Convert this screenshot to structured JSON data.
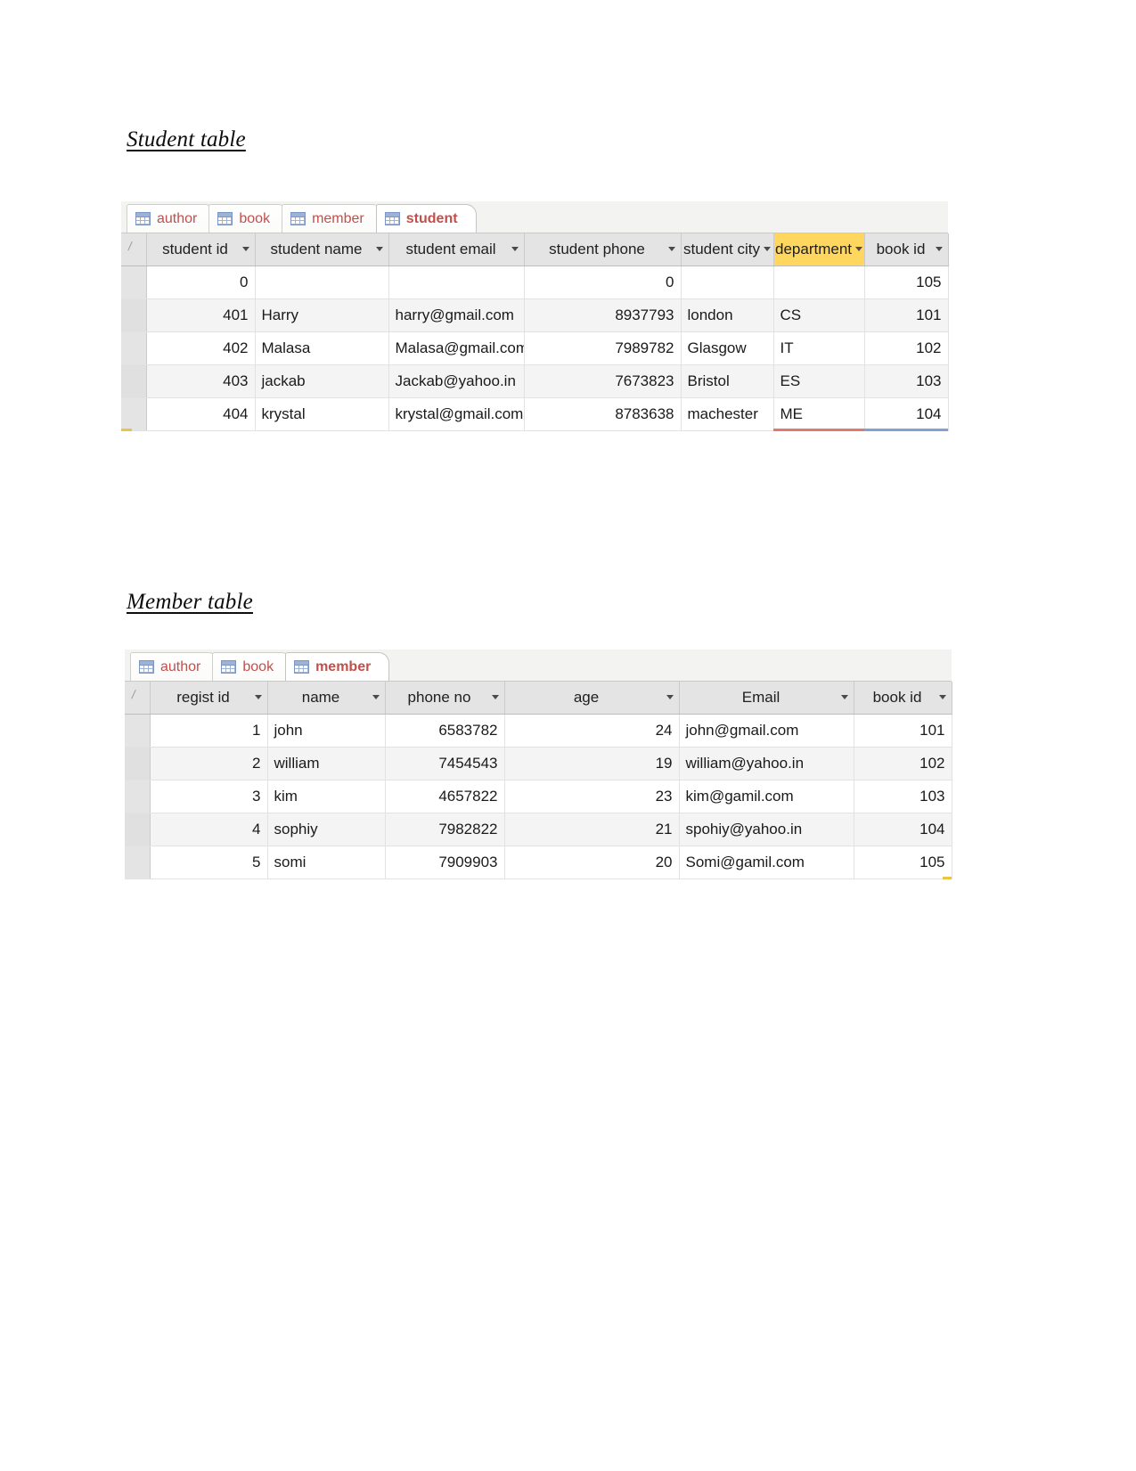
{
  "document": {
    "sections": [
      {
        "heading": "Student table"
      },
      {
        "heading": "Member table"
      }
    ]
  },
  "student_table": {
    "heading": "Student table",
    "tabs": [
      {
        "label": "author",
        "active": false,
        "icon": "table-grid-icon"
      },
      {
        "label": "book",
        "active": false,
        "icon": "table-grid-icon"
      },
      {
        "label": "member",
        "active": false,
        "icon": "table-grid-icon"
      },
      {
        "label": "student",
        "active": true,
        "icon": "table-grid-icon"
      }
    ],
    "columns": [
      {
        "label": "student id",
        "align": "num",
        "selected": false
      },
      {
        "label": "student name",
        "align": "txt",
        "selected": false
      },
      {
        "label": "student email",
        "align": "txt",
        "selected": false
      },
      {
        "label": "student phone",
        "align": "num",
        "selected": false
      },
      {
        "label": "student city",
        "align": "txt",
        "selected": false
      },
      {
        "label": "department",
        "align": "txt",
        "selected": true
      },
      {
        "label": "book id",
        "align": "num",
        "selected": false
      }
    ],
    "rows": [
      [
        "0",
        "",
        "",
        "0",
        "",
        "",
        "105"
      ],
      [
        "401",
        "Harry",
        "harry@gmail.com",
        "8937793",
        "london",
        "CS",
        "101"
      ],
      [
        "402",
        "Malasa",
        "Malasa@gmail.com",
        "7989782",
        "Glasgow",
        "IT",
        "102"
      ],
      [
        "403",
        "jackab",
        "Jackab@yahoo.in",
        "7673823",
        "Bristol",
        "ES",
        "103"
      ],
      [
        "404",
        "krystal",
        "krystal@gmail.com",
        "8783638",
        "machester",
        "ME",
        "104"
      ]
    ],
    "selected_column_color": "#ffd75e"
  },
  "member_table": {
    "heading": "Member table",
    "tabs": [
      {
        "label": "author",
        "active": false,
        "icon": "table-grid-icon"
      },
      {
        "label": "book",
        "active": false,
        "icon": "table-grid-icon"
      },
      {
        "label": "member",
        "active": true,
        "icon": "table-grid-icon"
      }
    ],
    "columns": [
      {
        "label": "regist id",
        "align": "num",
        "selected": false
      },
      {
        "label": "name",
        "align": "txt",
        "selected": false
      },
      {
        "label": "phone no",
        "align": "num",
        "selected": false
      },
      {
        "label": "age",
        "align": "num",
        "selected": false
      },
      {
        "label": "Email",
        "align": "txt",
        "selected": false
      },
      {
        "label": "book id",
        "align": "num",
        "selected": false
      }
    ],
    "rows": [
      [
        "1",
        "john",
        "6583782",
        "24",
        "john@gmail.com",
        "101"
      ],
      [
        "2",
        "william",
        "7454543",
        "19",
        "william@yahoo.in",
        "102"
      ],
      [
        "3",
        "kim",
        "4657822",
        "23",
        "kim@gamil.com",
        "103"
      ],
      [
        "4",
        "sophiy",
        "7982822",
        "21",
        "spohiy@yahoo.in",
        "104"
      ],
      [
        "5",
        "somi",
        "7909903",
        "20",
        "Somi@gamil.com",
        "105"
      ]
    ]
  }
}
